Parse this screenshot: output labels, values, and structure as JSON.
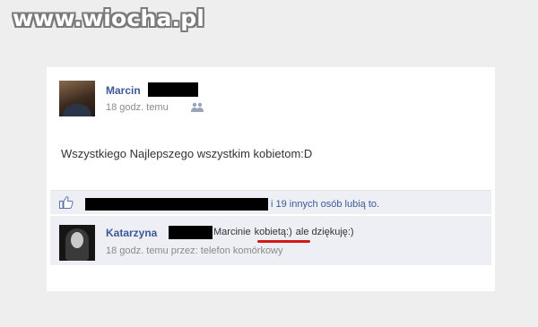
{
  "watermark": "www.wiocha.pl",
  "post": {
    "author": "Marcin",
    "time": "18 godz. temu",
    "audience_icon": "friends-icon",
    "message": "Wszystkiego Najlepszego wszystkim kobietom:D"
  },
  "likes": {
    "icon": "thumbs-up-icon",
    "text": "i 19 innych osób lubią to."
  },
  "comment": {
    "author": "Katarzyna",
    "text_before": "Marcinie",
    "highlighted": "kobietą:)",
    "text_after": "ale dziękuję:)",
    "time": "18 godz. temu przez:",
    "via": "telefon komórkowy"
  },
  "colors": {
    "link": "#3b5998",
    "meta": "#8a8a8a",
    "highlight_underline": "#d41818",
    "comment_background": "#edeff4"
  }
}
